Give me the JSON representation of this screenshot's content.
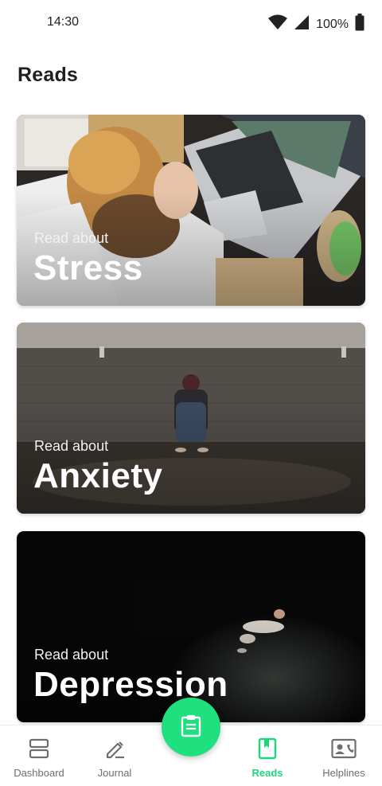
{
  "status_bar": {
    "time": "14:30",
    "battery": "100%",
    "icons": [
      "wifi-icon",
      "cellular-signal-icon",
      "battery-icon"
    ]
  },
  "page": {
    "title": "Reads"
  },
  "cards": [
    {
      "kicker": "Read about",
      "title": "Stress"
    },
    {
      "kicker": "Read about",
      "title": "Anxiety"
    },
    {
      "kicker": "Read about",
      "title": "Depression"
    }
  ],
  "fab": {
    "icon": "clipboard-icon"
  },
  "bottom_nav": {
    "items": [
      {
        "label": "Dashboard",
        "icon": "dashboard-icon",
        "active": false
      },
      {
        "label": "Journal",
        "icon": "pencil-icon",
        "active": false
      },
      {
        "label": "Reads",
        "icon": "bookmark-book-icon",
        "active": true
      },
      {
        "label": "Helplines",
        "icon": "contact-card-icon",
        "active": false
      }
    ]
  },
  "colors": {
    "accent": "#1ee07f",
    "active_label": "#1ed67a",
    "inactive": "#6e6e6e"
  }
}
